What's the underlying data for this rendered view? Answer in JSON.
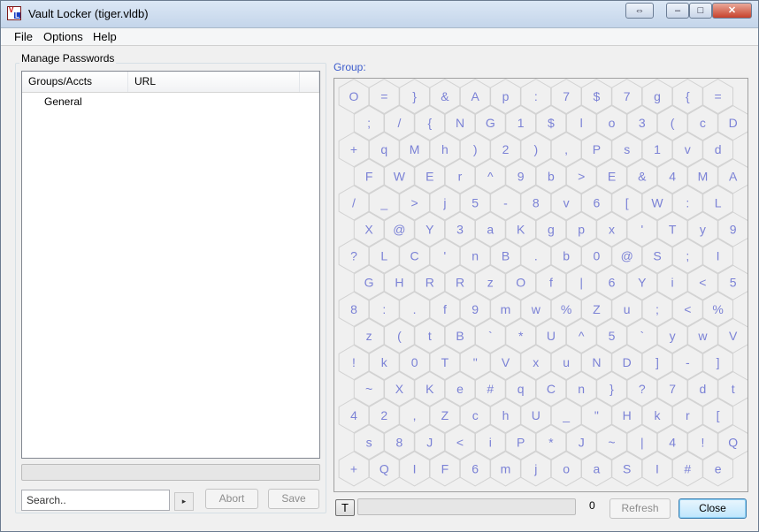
{
  "window": {
    "title": "Vault Locker (tiger.vldb)",
    "icon": "vl-app-icon",
    "icon_text_v": "V",
    "icon_text_l": "L",
    "controls": {
      "restore_glyph": "⇔",
      "minimize_glyph": "–",
      "maximize_glyph": "□",
      "close_glyph": "✕"
    }
  },
  "menu": {
    "file": "File",
    "options": "Options",
    "help": "Help"
  },
  "left": {
    "group_label": "Manage Passwords",
    "columns": {
      "groups": "Groups/Accts",
      "url": "URL"
    },
    "rows": [
      {
        "name": "General"
      }
    ],
    "search_placeholder": "Search..",
    "arrow_glyph": "▸",
    "abort_label": "Abort",
    "save_label": "Save"
  },
  "right": {
    "group_title": "Group:",
    "hex_rows": [
      [
        "O",
        "=",
        "}",
        "&",
        "A",
        "p",
        ":",
        "7",
        "$",
        "7",
        "g",
        "{",
        "="
      ],
      [
        ";",
        "/",
        "{",
        "N",
        "G",
        "1",
        "$",
        "l",
        "o",
        "3",
        "(",
        "c",
        "D"
      ],
      [
        "+",
        "q",
        "M",
        "h",
        ")",
        "2",
        ")",
        ",",
        "P",
        "s",
        "1",
        "v",
        "d"
      ],
      [
        "F",
        "W",
        "E",
        "r",
        "^",
        "9",
        "b",
        ">",
        "E",
        "&",
        "4",
        "M",
        "A"
      ],
      [
        "/",
        "_",
        ">",
        "j",
        "5",
        "-",
        "8",
        "v",
        "6",
        "[",
        "W",
        ":",
        "L"
      ],
      [
        "X",
        "@",
        "Y",
        "3",
        "a",
        "K",
        "g",
        "p",
        "x",
        "'",
        "T",
        "y",
        "9"
      ],
      [
        "?",
        "L",
        "C",
        "'",
        "n",
        "B",
        ".",
        "b",
        "0",
        "@",
        "S",
        ";",
        "I"
      ],
      [
        "G",
        "H",
        "R",
        "R",
        "z",
        "O",
        "f",
        "|",
        "6",
        "Y",
        "i",
        "<",
        "5"
      ],
      [
        "8",
        ":",
        ".",
        "f",
        "9",
        "m",
        "w",
        "%",
        "Z",
        "u",
        ";",
        "<",
        "%"
      ],
      [
        "z",
        "(",
        "t",
        "B",
        "`",
        "*",
        "U",
        "^",
        "5",
        "`",
        "y",
        "w",
        "V"
      ],
      [
        "!",
        "k",
        "0",
        "T",
        "\"",
        "V",
        "x",
        "u",
        "N",
        "D",
        "]",
        "-",
        "]"
      ],
      [
        "~",
        "X",
        "K",
        "e",
        "#",
        "q",
        "C",
        "n",
        "}",
        "?",
        "7",
        "d",
        "t"
      ],
      [
        "4",
        "2",
        ",",
        "Z",
        "c",
        "h",
        "U",
        "_",
        "\"",
        "H",
        "k",
        "r",
        "["
      ],
      [
        "s",
        "8",
        "J",
        "<",
        "i",
        "P",
        "*",
        "J",
        "~",
        "|",
        "4",
        "!",
        "Q"
      ],
      [
        "+",
        "Q",
        "I",
        "F",
        "6",
        "m",
        "j",
        "o",
        "a",
        "S",
        "I",
        "#",
        "e"
      ]
    ],
    "t_label": "T",
    "count": "0",
    "refresh_label": "Refresh",
    "close_label": "Close"
  },
  "colors": {
    "hex_text": "#7b82d6",
    "group_title": "#3b5bcc",
    "hex_line": "#d2d2d2"
  }
}
